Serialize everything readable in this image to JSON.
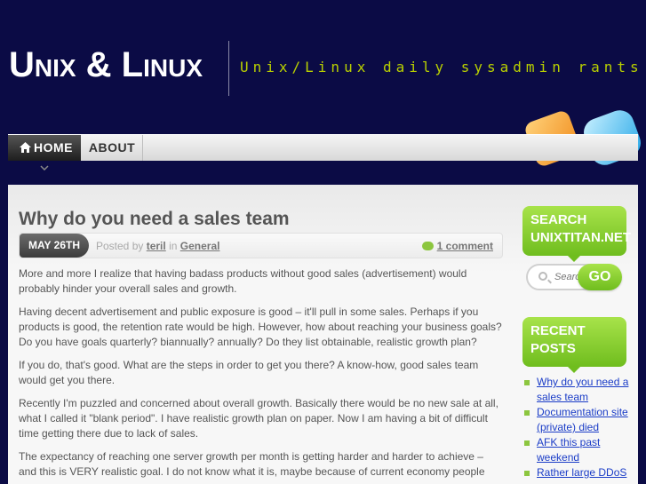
{
  "site": {
    "title": "Unix & Linux",
    "tagline": "Unix/Linux daily sysadmin rants!"
  },
  "nav": {
    "items": [
      {
        "label": "HOME"
      },
      {
        "label": "ABOUT"
      }
    ]
  },
  "post": {
    "title": "Why do you need a sales team",
    "date": "MAY 26TH",
    "posted_by_prefix": "Posted by",
    "author": "teril",
    "in_text": "in",
    "category": "General",
    "comments": "1 comment",
    "paragraphs": [
      "More and more I realize that having badass products without good sales (advertisement) would probably hinder your overall sales and growth.",
      "Having decent advertisement and public exposure is good – it'll pull in some sales. Perhaps if you products is good, the retention rate would be high. However, how about reaching your business goals? Do you have goals quarterly? biannually? annually? Do they list obtainable, realistic growth plan?",
      "If you do, that's good. What are the steps in order to get you there? A know-how, good sales team would get you there.",
      "Recently I'm puzzled and concerned about overall growth. Basically there would be no new sale at all, what I called it \"blank period\". I have realistic growth plan on paper. Now I am having a bit of difficult time getting there due to lack of sales.",
      "The expectancy of reaching one server growth per month is getting harder and harder to achieve – and this is VERY realistic goal. I do not know what it is, maybe because of current economy people are ..."
    ]
  },
  "sidebar": {
    "search_title": "SEARCH UNIXTITAN.NET",
    "search_placeholder": "Search",
    "search_button": "GO",
    "recent_title": "RECENT POSTS",
    "recent_posts": [
      "Why do you need a sales team",
      "Documentation site (private) died",
      "AFK this past weekend",
      "Rather large DDoS"
    ]
  }
}
